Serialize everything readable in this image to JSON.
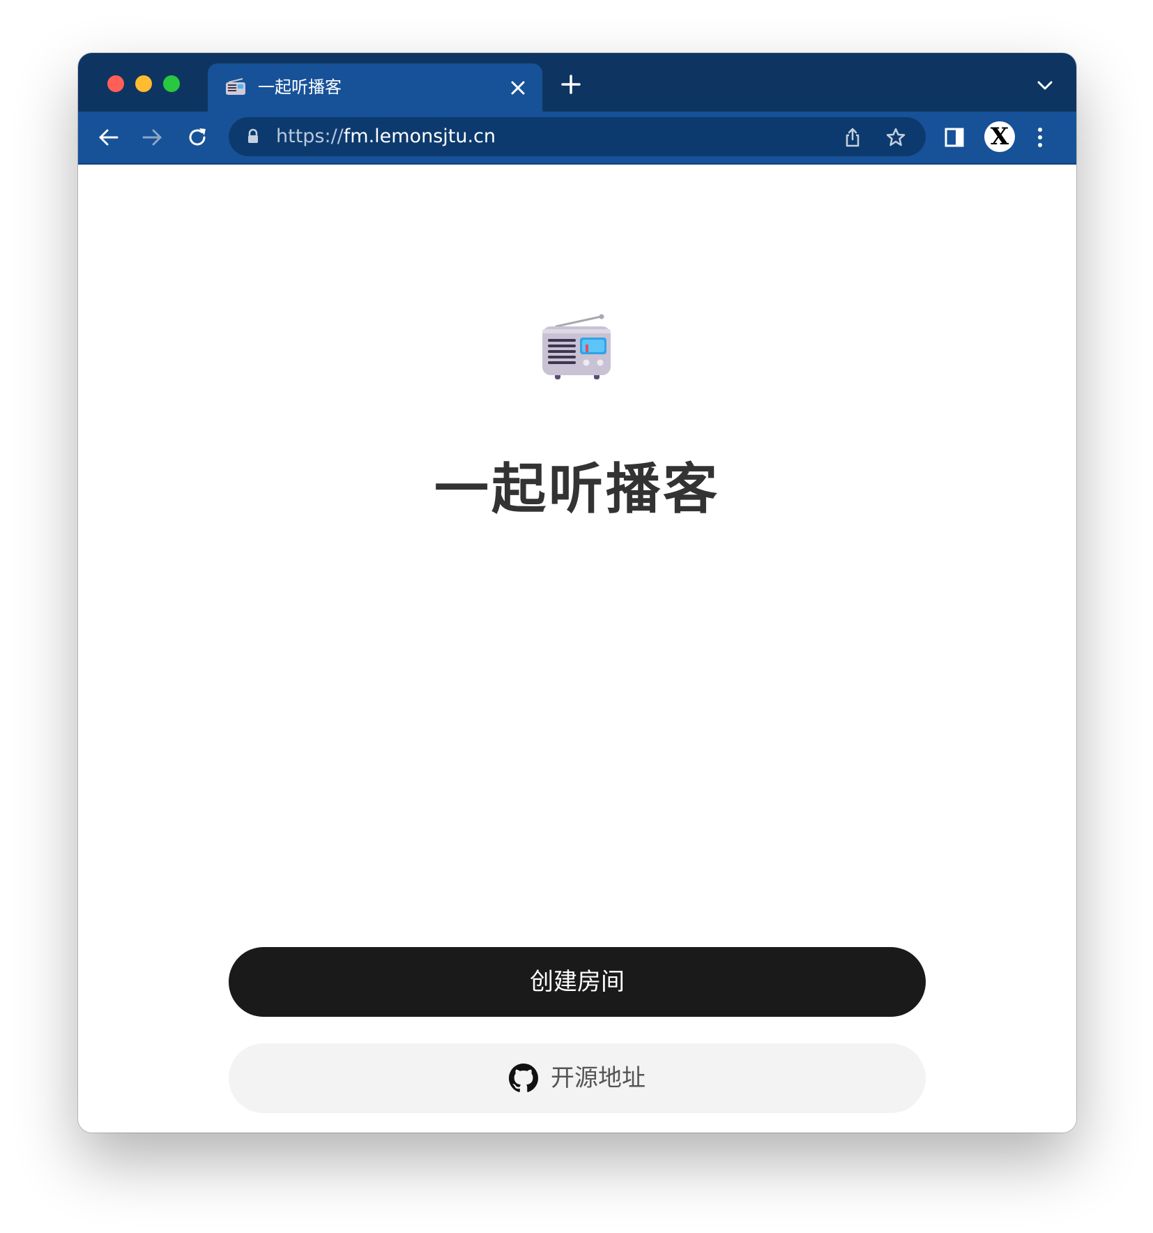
{
  "browser": {
    "tab": {
      "title": "一起听播客",
      "favicon": "radio-icon"
    },
    "address_bar": {
      "scheme": "https://",
      "host": "fm.lemonsjtu.cn"
    },
    "profile_initial": "X",
    "colors": {
      "tabbar": "#0e3561",
      "toolbar": "#175298",
      "omnibox": "#0d3a6e",
      "traffic_red": "#ff5f57",
      "traffic_yellow": "#febc2e",
      "traffic_green": "#28c840"
    }
  },
  "page": {
    "logo": "radio-icon",
    "title": "一起听播客",
    "create_room_label": "创建房间",
    "source_label": "开源地址",
    "source_icon": "github-icon",
    "colors": {
      "primary_button": "#1a1a1a",
      "secondary_button": "#f3f3f3",
      "title_text": "#333333"
    }
  }
}
